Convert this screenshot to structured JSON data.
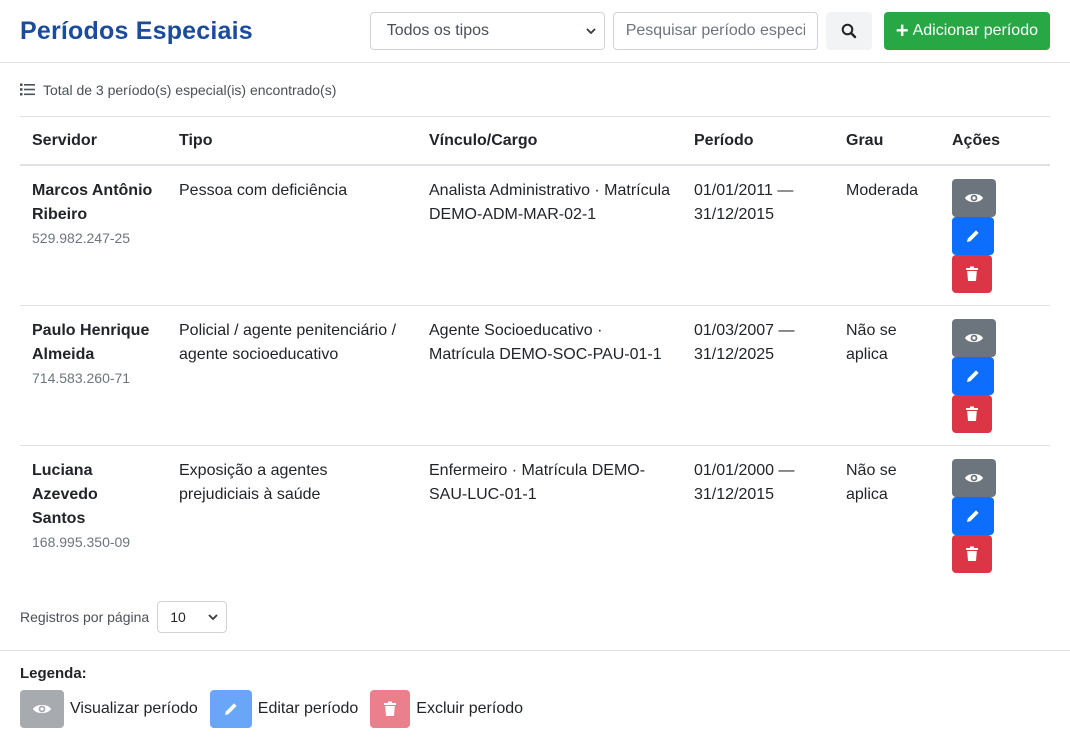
{
  "header": {
    "title": "Períodos Especiais",
    "type_filter_value": "Todos os tipos",
    "search_placeholder": "Pesquisar período especial",
    "add_label": "Adicionar período"
  },
  "summary": {
    "total_text": "Total de 3 período(s) especial(is) encontrado(s)"
  },
  "table": {
    "columns": [
      "Servidor",
      "Tipo",
      "Vínculo/Cargo",
      "Período",
      "Grau",
      "Ações"
    ],
    "rows": [
      {
        "name": "Marcos Antônio Ribeiro",
        "cpf": "529.982.247-25",
        "tipo": "Pessoa com deficiência",
        "vinculo": "Analista Administrativo · Matrícula DEMO-ADM-MAR-02-1",
        "periodo": "01/01/2011 — 31/12/2015",
        "grau": "Moderada"
      },
      {
        "name": "Paulo Henrique Almeida",
        "cpf": "714.583.260-71",
        "tipo": "Policial / agente penitenciário / agente socioeducativo",
        "vinculo": "Agente Socioeducativo · Matrícula DEMO-SOC-PAU-01-1",
        "periodo": "01/03/2007 — 31/12/2025",
        "grau": "Não se aplica"
      },
      {
        "name": "Luciana Azevedo Santos",
        "cpf": "168.995.350-09",
        "tipo": "Exposição a agentes prejudiciais à saúde",
        "vinculo": "Enfermeiro · Matrícula DEMO-SAU-LUC-01-1",
        "periodo": "01/01/2000 — 31/12/2015",
        "grau": "Não se aplica"
      }
    ]
  },
  "pagination": {
    "label": "Registros por página",
    "value": "10"
  },
  "legend": {
    "title": "Legenda:",
    "view": "Visualizar período",
    "edit": "Editar período",
    "delete": "Excluir período"
  },
  "colors": {
    "title": "#1a4b9c",
    "add": "#28a745",
    "view": "#6c757d",
    "edit": "#0d6efd",
    "delete": "#dc3545"
  },
  "icons": [
    "list-icon",
    "search-icon",
    "plus-icon",
    "eye-icon",
    "pencil-icon",
    "trash-icon",
    "chevron-down-icon"
  ]
}
